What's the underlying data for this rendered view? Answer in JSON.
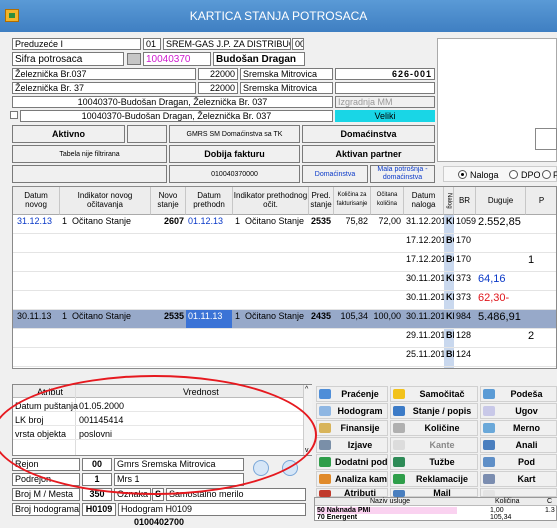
{
  "window": {
    "title": "KARTICA STANJA POTROSACA",
    "app_icon": "app-icon"
  },
  "header": {
    "company": "Preduzeće I",
    "company_code": "01",
    "company_name": "SREM-GAS J.P. ZA DISTRIBUCIJU",
    "company_extra": "00",
    "sifra_label": "Sifra potrosaca",
    "sifra_value": "10040370",
    "consumer_name": "Budošan Dragan",
    "addr1": "Železnička Br.037",
    "zip1": "22000",
    "city1": "Sremska Mitrovica",
    "meter": "626-001",
    "addr2": "Železnička Br. 37",
    "zip2": "22000",
    "city2": "Sremska Mitrovica",
    "line1": "10040370-Budošan Dragan, Železnička Br. 037",
    "izgradnja": "Izgradnja MM",
    "line2": "10040370-Budošan Dragan, Železnička Br. 037",
    "size": "Veliki",
    "aktivno": "Aktivno",
    "gmrs": "GMRS SM Domaćinstva sa TK",
    "domacinstva": "Domaćinstva",
    "tabela": "Tabela nije filtrirana",
    "dobija": "Dobija fakturu",
    "aktivan": "Aktivan partner",
    "code2": "010040370000",
    "domacinstva2": "Domaćinstva",
    "mala": "Mala potrošnja - domaćinstva",
    "radio_nalog": "Naloga",
    "radio_dpo": "DPO",
    "radio_f": "F"
  },
  "grid": {
    "headers": [
      "Datum novog",
      "Indikator novog očitavanja",
      "Novo stanje",
      "Datum prethodn",
      "Indikator prethodnog očit.",
      "Pred. stanje",
      "Količina za fakturisanje",
      "Očitana količina",
      "Datum naloga",
      "Nalog",
      "BR",
      "Duguje",
      "P"
    ],
    "rows": [
      {
        "datum": "31.12.13",
        "i": "1",
        "ind": "Očitano Stanje",
        "novo": "2607",
        "dprev": "01.12.13",
        "i2": "1",
        "ind2": "Očitano Stanje",
        "pred": "2535",
        "kol": "75,82",
        "oc": "72,00",
        "dnal": "31.12.2013",
        "nalog": "KF",
        "br": "1059",
        "dug": "2.552,85",
        "p": "",
        "sel": false
      },
      {
        "datum": "",
        "i": "",
        "ind": "",
        "novo": "",
        "dprev": "",
        "i2": "",
        "ind2": "",
        "pred": "",
        "kol": "",
        "oc": "",
        "dnal": "17.12.2013",
        "nalog": "BG",
        "br": "170",
        "dug": "",
        "p": "",
        "sel": false
      },
      {
        "datum": "",
        "i": "",
        "ind": "",
        "novo": "",
        "dprev": "",
        "i2": "",
        "ind2": "",
        "pred": "",
        "kol": "",
        "oc": "",
        "dnal": "17.12.2013",
        "nalog": "BG",
        "br": "170",
        "dug": "",
        "p": "1",
        "sel": false
      },
      {
        "datum": "",
        "i": "",
        "ind": "",
        "novo": "",
        "dprev": "",
        "i2": "",
        "ind2": "",
        "pred": "",
        "kol": "",
        "oc": "",
        "dnal": "30.11.2013",
        "nalog": "KM",
        "br": "373",
        "dug": "64,16",
        "p": "",
        "sel": false
      },
      {
        "datum": "",
        "i": "",
        "ind": "",
        "novo": "",
        "dprev": "",
        "i2": "",
        "ind2": "",
        "pred": "",
        "kol": "",
        "oc": "",
        "dnal": "30.11.2013",
        "nalog": "KM",
        "br": "373",
        "dug": "62,30-",
        "p": "",
        "sel": false
      },
      {
        "datum": "30.11.13",
        "i": "1",
        "ind": "Očitano Stanje",
        "novo": "2535",
        "dprev": "01.11.13",
        "i2": "1",
        "ind2": "Očitano Stanje",
        "pred": "2435",
        "kol": "105,34",
        "oc": "100,00",
        "dnal": "30.11.2013",
        "nalog": "KF",
        "br": "984",
        "dug": "5.486,91",
        "p": "",
        "sel": true
      },
      {
        "datum": "",
        "i": "",
        "ind": "",
        "novo": "",
        "dprev": "",
        "i2": "",
        "ind2": "",
        "pred": "",
        "kol": "",
        "oc": "",
        "dnal": "29.11.2013",
        "nalog": "BB",
        "br": "128",
        "dug": "",
        "p": "2",
        "sel": false
      },
      {
        "datum": "",
        "i": "",
        "ind": "",
        "novo": "",
        "dprev": "",
        "i2": "",
        "ind2": "",
        "pred": "",
        "kol": "",
        "oc": "",
        "dnal": "25.11.2013",
        "nalog": "BB",
        "br": "124",
        "dug": "",
        "p": "",
        "sel": false
      }
    ]
  },
  "attributes": {
    "headers": [
      "Atribut",
      "Vrednost"
    ],
    "rows": [
      {
        "name": "Datum puštanja",
        "value": "01.05.2000"
      },
      {
        "name": "LK broj",
        "value": "001145414"
      },
      {
        "name": "vrsta objekta",
        "value": "poslovni"
      }
    ]
  },
  "buttons": {
    "pracenje": "Praćenje",
    "samocitac": "Samočitač",
    "podesa": "Podeša",
    "hodogram": "Hodogram",
    "stanje": "Stanje / popis",
    "ugov": "Ugov",
    "finansije": "Finansije",
    "kolicine": "Količine",
    "merno": "Merno",
    "izjave": "Izjave",
    "kante": "Kante",
    "anali": "Anali",
    "dodatni": "Dodatni podaci",
    "tuzbe": "Tužbe",
    "pod": "Pod",
    "analiza": "Analiza kamata",
    "reklamacije": "Reklamacije",
    "kart": "Kart",
    "atributi": "Atributi",
    "mail": "Mail"
  },
  "bottom": {
    "rejon_label": "Rejon",
    "rejon_code": "00",
    "rejon_value": "Gmrs Sremska Mitrovica",
    "podrejon_label": "Podrejon",
    "podrejon_code": "1",
    "podrejon_value": "Mrs 1",
    "broj_label": "Broj M / Mesta",
    "broj_code": "350",
    "oznaka_label": "Oznaka",
    "oznaka_code": "S",
    "oznaka_value": "Samostalno merilo",
    "hodogram_label": "Broj hodograma",
    "hodogram_code": "H0109",
    "hodogram_value": "Hodogram H0109",
    "last": "0100402700"
  },
  "services": {
    "headers": [
      "Naziv usluge",
      "Količina",
      "C"
    ],
    "rows": [
      {
        "code": "50",
        "name": "Naknada PMI",
        "qty": "1,00",
        "c": "1.3"
      },
      {
        "code": "70",
        "name": "Energent",
        "qty": "105,34",
        "c": ""
      }
    ]
  },
  "colors": {
    "title_bar": "#3f7fc2",
    "selection": "#97a9c9",
    "highlight_ellipse": "#e6191f",
    "consumer_code": "#d01bd0",
    "link_blue": "#0a39c8",
    "negative_red": "#e0151b"
  }
}
